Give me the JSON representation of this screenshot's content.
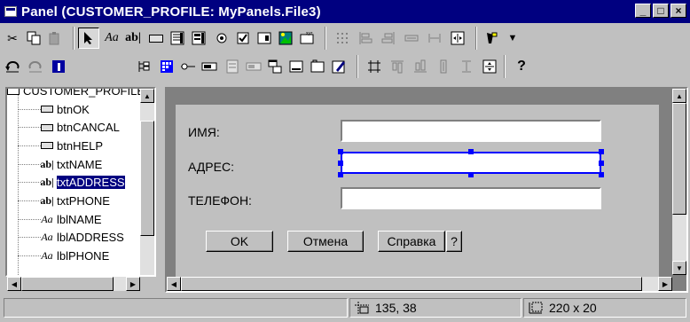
{
  "window": {
    "title": "Panel (CUSTOMER_PROFILE: MyPanels.File3)",
    "minimize": "_",
    "maximize": "□",
    "close": "×"
  },
  "toolbar": {
    "text_label_tool": "Aa",
    "entry_tool": "ab|",
    "help_tool": "?"
  },
  "tree": {
    "root": "CUSTOMER_PROFILE",
    "items": [
      {
        "icon": "button",
        "label": "btnOK"
      },
      {
        "icon": "button",
        "label": "btnCANCAL"
      },
      {
        "icon": "button",
        "label": "btnHELP"
      },
      {
        "icon": "entry",
        "label": "txtNAME"
      },
      {
        "icon": "entry",
        "label": "txtADDRESS",
        "selected": true
      },
      {
        "icon": "entry",
        "label": "txtPHONE"
      },
      {
        "icon": "text",
        "label": "lblNAME"
      },
      {
        "icon": "text",
        "label": "lblADDRESS"
      },
      {
        "icon": "text",
        "label": "lblPHONE"
      }
    ],
    "entry_glyph": "ab|",
    "text_glyph": "Aa"
  },
  "form": {
    "name_label": "ИМЯ:",
    "address_label": "АДРЕС:",
    "phone_label": "ТЕЛЕФОН:",
    "name_value": "",
    "address_value": "",
    "phone_value": "",
    "ok_label": "OK",
    "cancel_label": "Отмена",
    "help_label": "Справка",
    "question_label": "?"
  },
  "status": {
    "position": "135, 38",
    "size": "220 x 20"
  },
  "colors": {
    "title_bar": "#000080",
    "selection": "#0000ff",
    "face": "#c0c0c0"
  }
}
